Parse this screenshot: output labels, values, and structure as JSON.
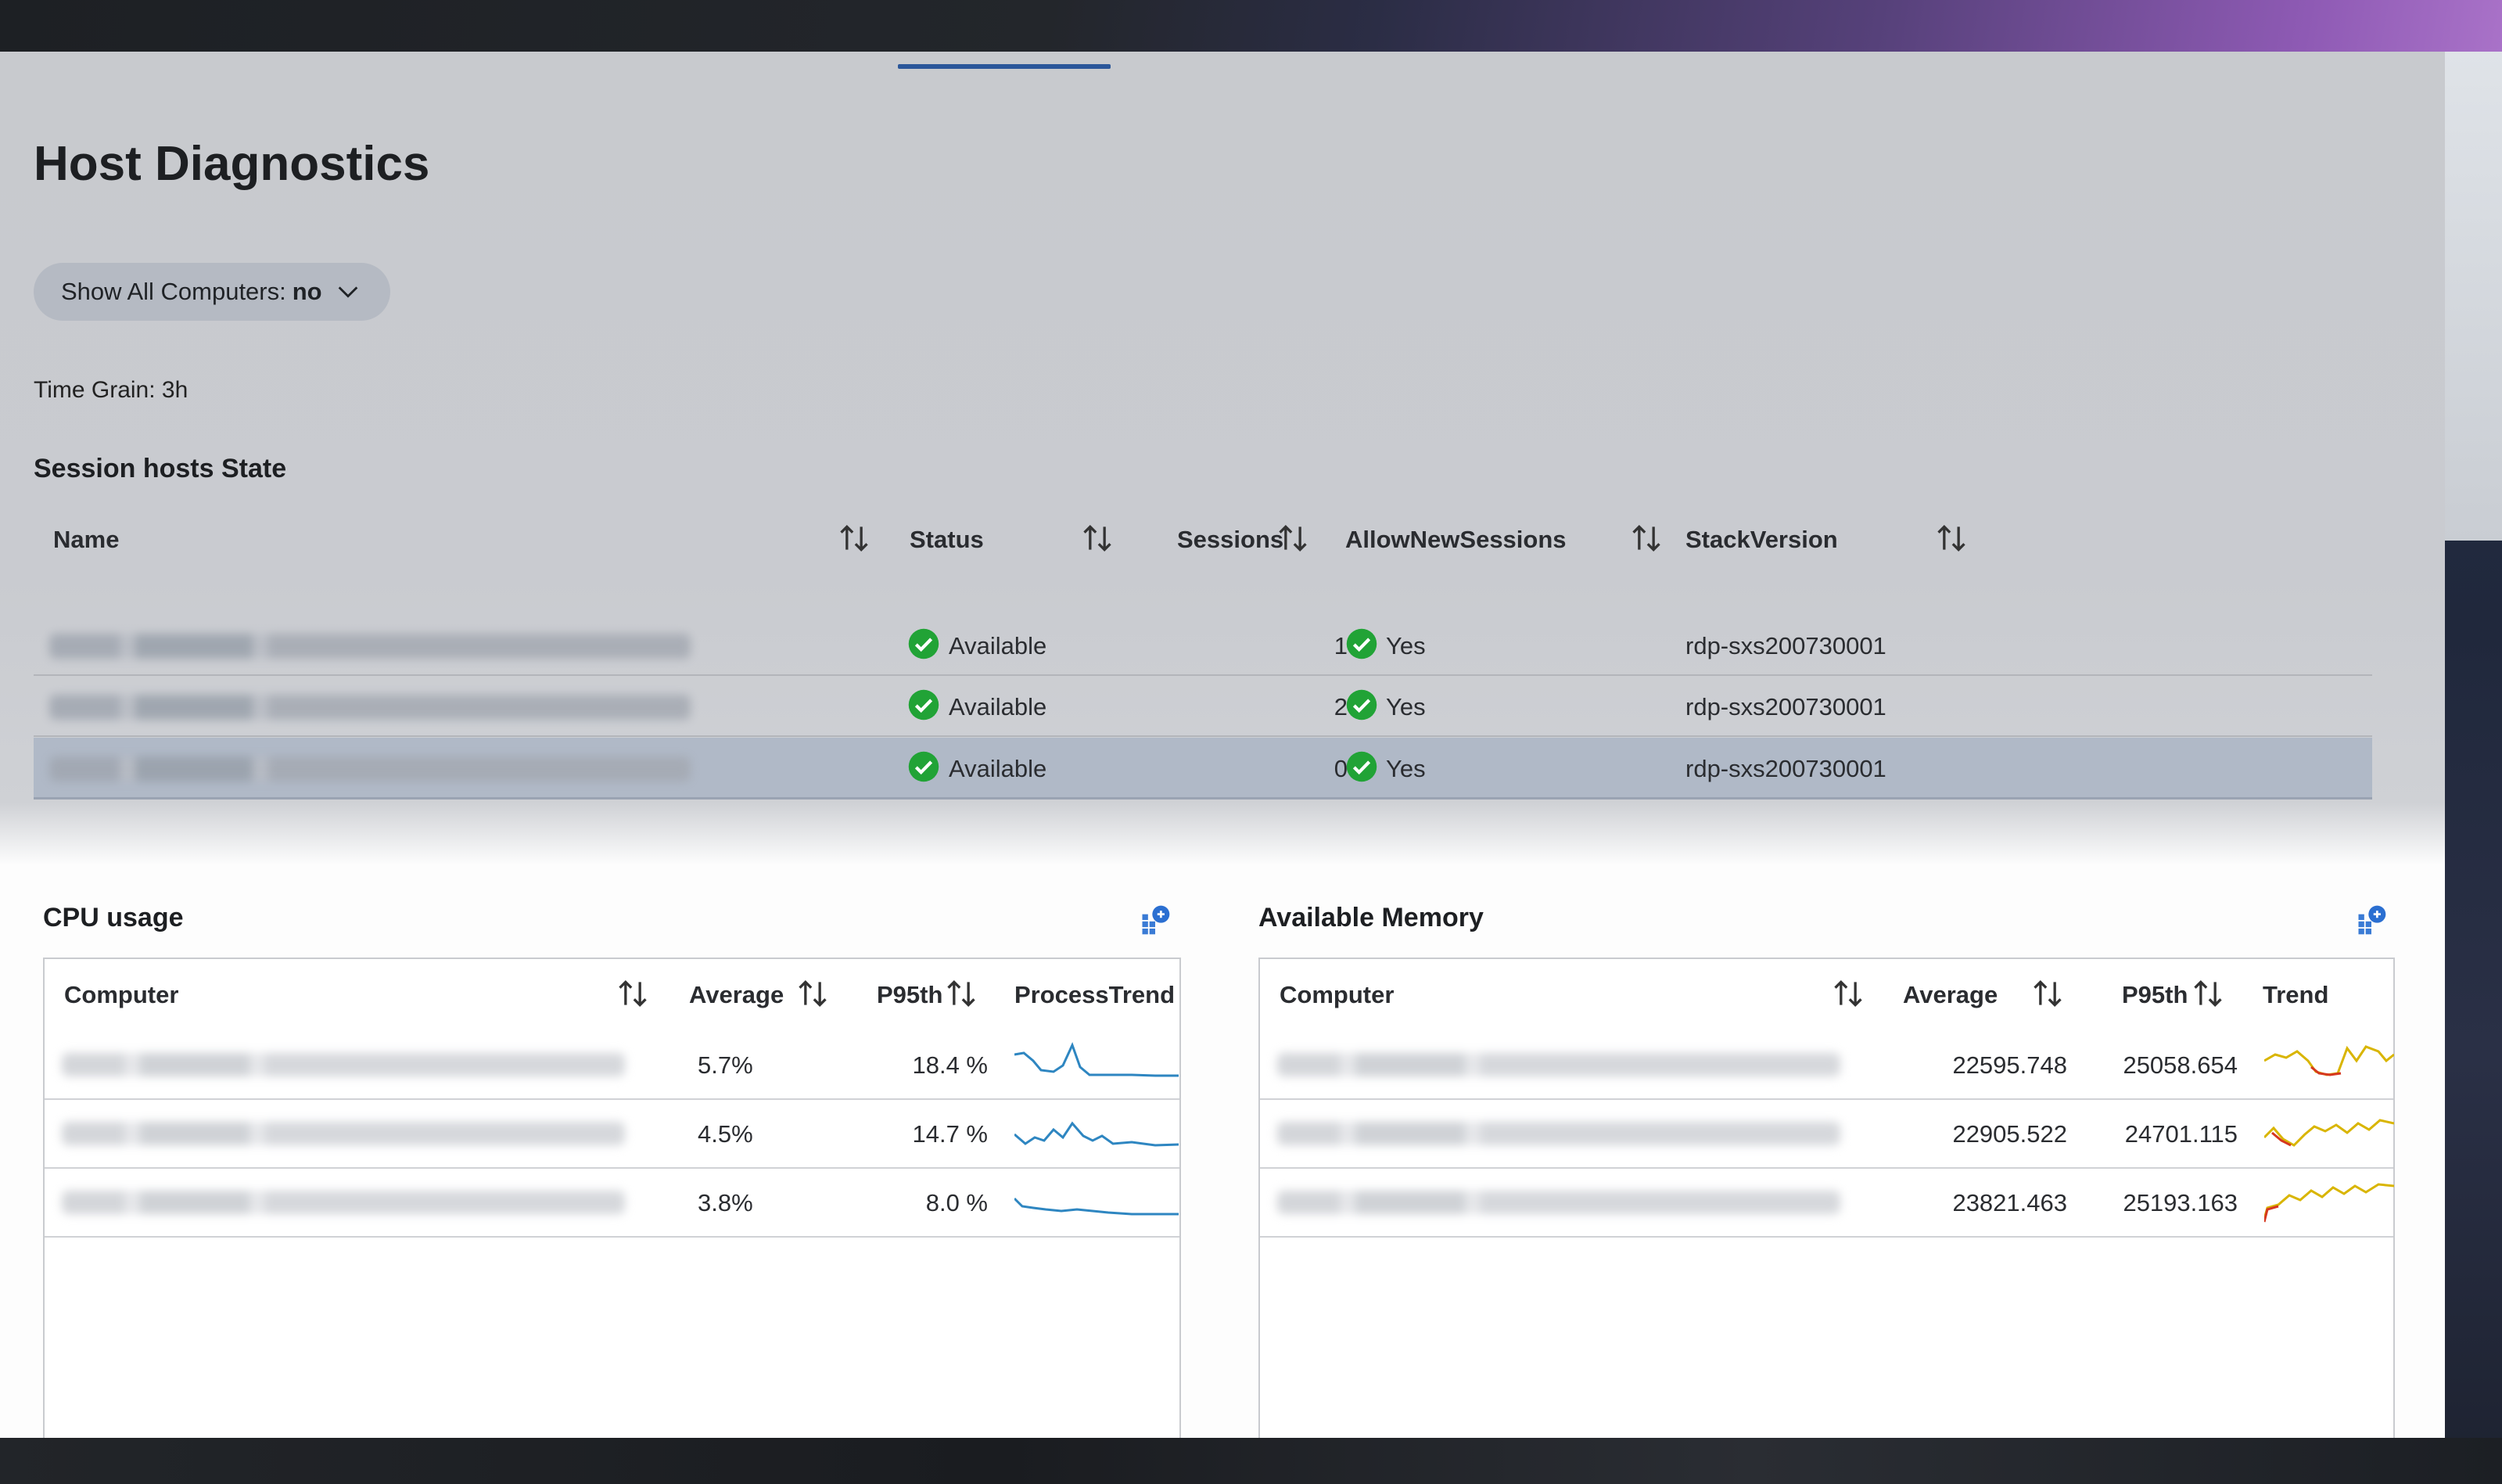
{
  "page": {
    "title": "Host Diagnostics",
    "filter": {
      "label": "Show All Computers:",
      "value": "no"
    },
    "time_grain": "Time Grain: 3h"
  },
  "session_hosts": {
    "title": "Session hosts State",
    "columns": [
      "Name",
      "Status",
      "Sessions",
      "AllowNewSessions",
      "StackVersion"
    ],
    "rows": [
      {
        "status": "Available",
        "sessions": "1",
        "allow_new": "Yes",
        "stack": "rdp-sxs200730001",
        "selected": false
      },
      {
        "status": "Available",
        "sessions": "2",
        "allow_new": "Yes",
        "stack": "rdp-sxs200730001",
        "selected": false
      },
      {
        "status": "Available",
        "sessions": "0",
        "allow_new": "Yes",
        "stack": "rdp-sxs200730001",
        "selected": true
      }
    ]
  },
  "cpu": {
    "title": "CPU usage",
    "columns": [
      "Computer",
      "Average",
      "P95th",
      "ProcessTrend"
    ],
    "rows": [
      {
        "average": "5.7%",
        "p95": "18.4 %"
      },
      {
        "average": "4.5%",
        "p95": "14.7 %"
      },
      {
        "average": "3.8%",
        "p95": "8.0 %"
      }
    ],
    "trend_color": "#2e86c1"
  },
  "memory": {
    "title": "Available Memory",
    "columns": [
      "Computer",
      "Average",
      "P95th",
      "Trend"
    ],
    "rows": [
      {
        "average": "22595.748",
        "p95": "25058.654"
      },
      {
        "average": "22905.522",
        "p95": "24701.115"
      },
      {
        "average": "23821.463",
        "p95": "25193.163"
      }
    ],
    "trend_colors": [
      "#d9b500",
      "#d6371f"
    ]
  },
  "icons": {
    "sort": "sort-arrows-icon",
    "status_ok": "green-check-icon",
    "dropdown": "chevron-down-icon",
    "pin": "pin-to-dashboard-icon"
  },
  "colors": {
    "status_ok": "#21a336",
    "selected_row": "#b0b9c7",
    "accent": "#2b579a"
  }
}
